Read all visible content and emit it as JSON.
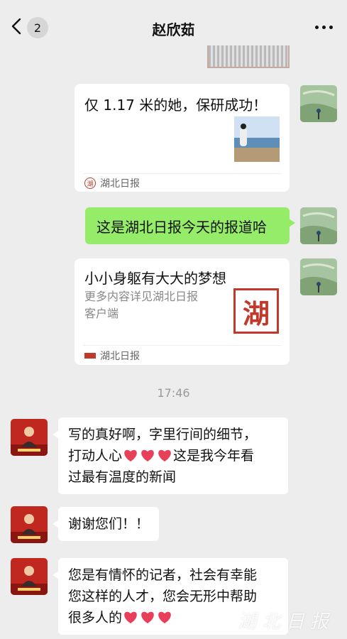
{
  "header": {
    "title": "赵欣茹",
    "unread_count": "2",
    "back_icon": "chevron-left-icon",
    "more_icon": "more-dots-icon"
  },
  "messages": {
    "card1": {
      "title": "仅 1.17 米的她，保研成功！",
      "source": "湖北日报"
    },
    "text1": "这是湖北日报今天的报道哈",
    "card2": {
      "title": "小小身躯有大大的梦想",
      "desc_line1": "更多内容详见湖北日报",
      "desc_line2": "客户端",
      "logo_char": "湖",
      "source": "湖北日报"
    },
    "timestamp": "17:46",
    "reply1": {
      "line1": "写的真好啊，字里行间的细节，",
      "line2a": "打动人心",
      "line2b": "这是我今年看",
      "line3": "过最有温度的新闻"
    },
    "reply2": "谢谢您们！！",
    "reply3": {
      "line1": "您是有情怀的记者，社会有幸能",
      "line2": "您这样的人才，您会无形中帮助",
      "line3": "很多人的"
    }
  },
  "watermark": "湖北日报",
  "colors": {
    "background": "#ededed",
    "sent_bubble": "#95ec69",
    "received_bubble": "#ffffff",
    "heart": "#e8405a",
    "brand_red": "#c0392b"
  }
}
